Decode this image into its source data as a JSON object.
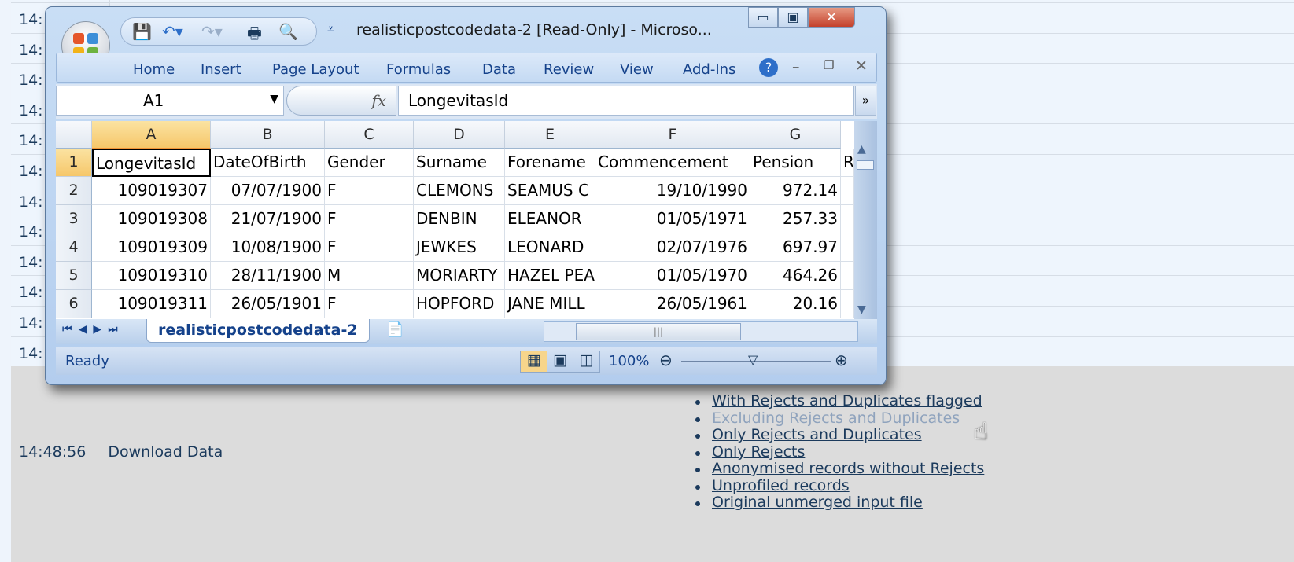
{
  "page": {
    "times_truncated": [
      "14:",
      "14:",
      "14:",
      "14:",
      "14:",
      "14:",
      "14:",
      "14:",
      "14:",
      "14:",
      "14:",
      "14:"
    ],
    "download_time": "14:48:56",
    "download_label": "Download Data",
    "links": [
      {
        "label": "With Rejects and Duplicates flagged",
        "visited": false
      },
      {
        "label": "Excluding Rejects and Duplicates",
        "visited": true
      },
      {
        "label": "Only Rejects and Duplicates",
        "visited": false
      },
      {
        "label": "Only Rejects",
        "visited": false
      },
      {
        "label": "Anonymised records without Rejects",
        "visited": false
      },
      {
        "label": "Unprofiled records",
        "visited": false
      },
      {
        "label": "Original unmerged input file",
        "visited": false
      }
    ]
  },
  "excel": {
    "title": "realisticpostcodedata-2  [Read-Only] - Microso...",
    "ribbon_tabs": [
      "Home",
      "Insert",
      "Page Layout",
      "Formulas",
      "Data",
      "Review",
      "View",
      "Add-Ins"
    ],
    "name_box": "A1",
    "formula_value": "LongevitasId",
    "columns": [
      "A",
      "B",
      "C",
      "D",
      "E",
      "F",
      "G"
    ],
    "rows": [
      [
        "1",
        "LongevitasId",
        "DateOfBirth",
        "Gender",
        "Surname",
        "Forename",
        "Commencement",
        "Pension",
        "R"
      ],
      [
        "2",
        "109019307",
        "07/07/1900",
        "F",
        "CLEMONS",
        "SEAMUS C",
        "19/10/1990",
        "972.14",
        ""
      ],
      [
        "3",
        "109019308",
        "21/07/1900",
        "F",
        "DENBIN",
        "ELEANOR",
        "01/05/1971",
        "257.33",
        ""
      ],
      [
        "4",
        "109019309",
        "10/08/1900",
        "F",
        "JEWKES",
        "LEONARD",
        "02/07/1976",
        "697.97",
        ""
      ],
      [
        "5",
        "109019310",
        "28/11/1900",
        "M",
        "MORIARTY",
        "HAZEL PEA",
        "01/05/1970",
        "464.26",
        ""
      ],
      [
        "6",
        "109019311",
        "26/05/1901",
        "F",
        "HOPFORD",
        "JANE MILL",
        "26/05/1961",
        "20.16",
        ""
      ]
    ],
    "sheet_tab": "realisticpostcodedata-2",
    "status": "Ready",
    "zoom": "100%"
  }
}
